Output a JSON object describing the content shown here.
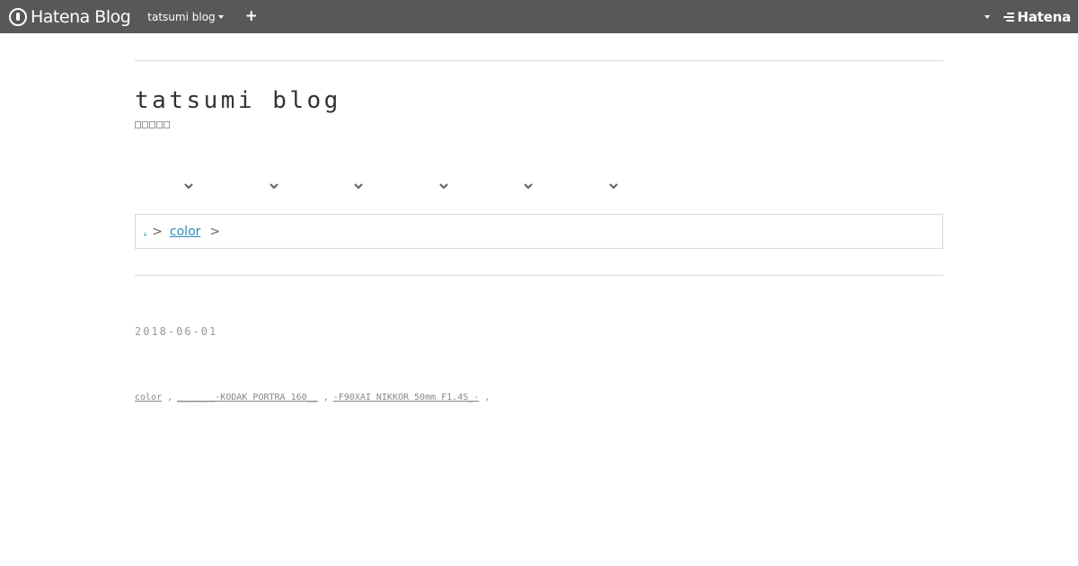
{
  "navbar": {
    "logo_text": "Hatena Blog",
    "blog_switch_label": "tatsumi blog",
    "add_label": "+",
    "hatena_label": "Hatena"
  },
  "blog": {
    "title": "tatsumi blog"
  },
  "category_menu": {
    "items": [
      "",
      "",
      "",
      "",
      "",
      ""
    ]
  },
  "breadcrumb": {
    "home_label": ".",
    "separator": ">",
    "current_label": "color"
  },
  "archive": {
    "date": "2018-06-01"
  },
  "entry": {
    "category": "color",
    "sep": ",",
    "film_title": "_______-KODAK PORTRA 160__",
    "sep2": ",",
    "camera_title": "-F90XAI NIKKOR 50mm F1.4S_-",
    "sep3": ","
  },
  "colors": {
    "navbar": "#585858",
    "link": "#2a8cb8",
    "rule": "#d8d8d8"
  }
}
